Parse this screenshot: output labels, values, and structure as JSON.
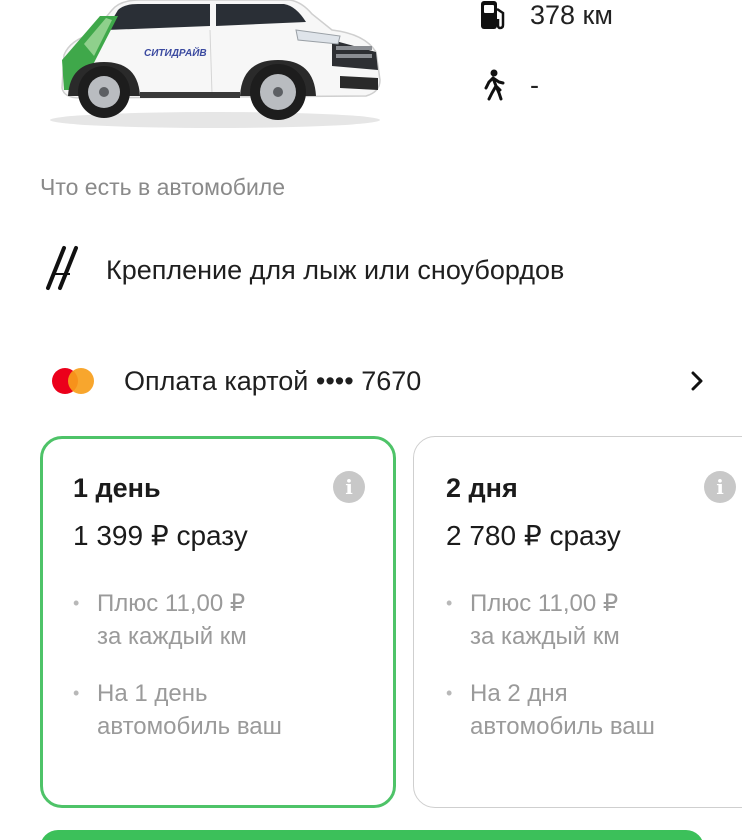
{
  "car": {
    "brand_text": "СИТИДРАЙВ"
  },
  "stats": {
    "fuel": {
      "icon": "fuel-pump-icon",
      "value": "378 км"
    },
    "walk": {
      "icon": "walking-person-icon",
      "value": "-"
    }
  },
  "features": {
    "section_title": "Что есть в автомобиле",
    "items": [
      {
        "icon": "ski-rack-icon",
        "label": "Крепление для лыж или сноубордов"
      }
    ]
  },
  "payment": {
    "icon": "mastercard-logo-icon",
    "label": "Оплата картой •••• 7670",
    "chevron": "chevron-right-icon"
  },
  "tariffs": [
    {
      "title": "1 день",
      "price": "1 399 ₽ сразу",
      "bullets": [
        "Плюс 11,00 ₽\nза каждый км",
        "На 1 день\nавтомобиль ваш"
      ],
      "selected": true
    },
    {
      "title": "2 дня",
      "price": "2 780 ₽ сразу",
      "bullets": [
        "Плюс 11,00 ₽\nза каждый км",
        "На 2 дня\nавтомобиль ваш"
      ],
      "selected": false
    }
  ],
  "colors": {
    "accent_green": "#4ec368",
    "button_green": "#3cc05a",
    "muted_text": "#8a8a8a",
    "mastercard_red": "#eb001b",
    "mastercard_orange": "#f79e1b"
  }
}
